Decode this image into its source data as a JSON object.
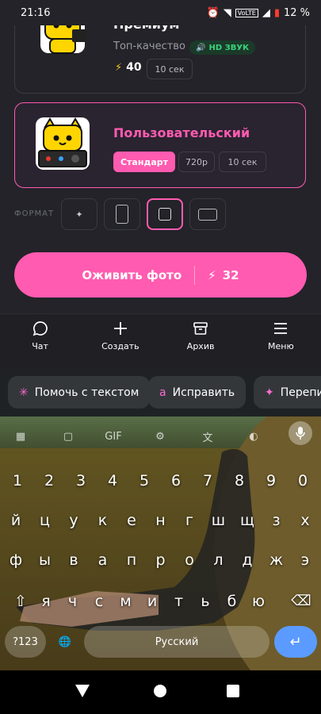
{
  "status": {
    "time": "21:16",
    "battery": "12 %",
    "volte": "VoLTE"
  },
  "cards": [
    {
      "title": "Премиум",
      "subtitle": "Топ-качество",
      "badge": "HD ЗВУК",
      "cost": "40",
      "duration": "10 сек"
    },
    {
      "title": "Пользовательский",
      "quality": "Стандарт",
      "resolution": "720p",
      "duration": "10 сек"
    }
  ],
  "format": {
    "label": "ФОРМАТ",
    "options": [
      "auto",
      "portrait",
      "square",
      "landscape"
    ],
    "selected": "square"
  },
  "cta": {
    "label": "Оживить фото",
    "cost": "32"
  },
  "nav": [
    {
      "label": "Чат",
      "icon": "chat-icon"
    },
    {
      "label": "Создать",
      "icon": "plus-icon"
    },
    {
      "label": "Архив",
      "icon": "archive-icon"
    },
    {
      "label": "Меню",
      "icon": "menu-icon"
    }
  ],
  "keyboard": {
    "suggestions": [
      "Помочь с текстом",
      "Исправить",
      "Перепи"
    ],
    "gif": "GIF",
    "numbers": [
      "1",
      "2",
      "3",
      "4",
      "5",
      "6",
      "7",
      "8",
      "9",
      "0"
    ],
    "row1": [
      "й",
      "ц",
      "у",
      "к",
      "е",
      "н",
      "г",
      "ш",
      "щ",
      "з",
      "х"
    ],
    "row2": [
      "ф",
      "ы",
      "в",
      "а",
      "п",
      "р",
      "о",
      "л",
      "д",
      "ж",
      "э"
    ],
    "row3": [
      "я",
      "ч",
      "с",
      "м",
      "и",
      "т",
      "ь",
      "б",
      "ю"
    ],
    "symbols": "?123",
    "space": "Русский"
  },
  "colors": {
    "accent": "#ff5bb0",
    "bg": "#232329",
    "badge_green": "#39d27a",
    "enter": "#5b9bff"
  }
}
